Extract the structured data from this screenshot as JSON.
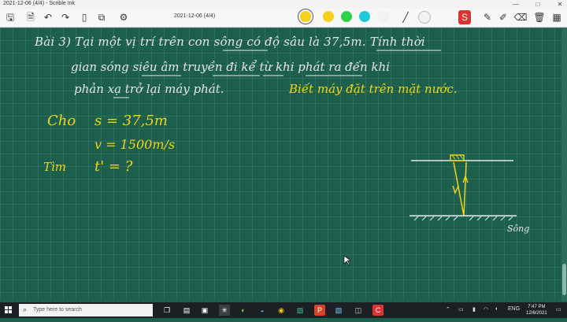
{
  "window": {
    "title": "2021-12-06 (4/4) - Scrible Ink",
    "minimize": "—",
    "maximize": "□",
    "close": "✕"
  },
  "toolbar": {
    "doc_title": "2021-12-06 (4/4)",
    "colors": [
      "#f5d11a",
      "#f5d11a",
      "#2fd34a",
      "#1ec8d8",
      "#f2f2f2"
    ]
  },
  "board": {
    "line1": "Bài 3)  Tại một vị trí trên con sông có độ sâu là 37,5m. Tính thời",
    "line2": "gian sóng siêu âm truyền đi kể từ khi phát ra đến khi",
    "line3_white": "phản xạ trở lại máy phát.",
    "line3_yellow": "Biết máy đặt trên mặt nước.",
    "given_label": "Cho",
    "given_s": "s = 37,5m",
    "given_v": "v = 1500m/s",
    "find_label": "Tìm",
    "find_t": "t' = ?",
    "diagram_label": "Sông"
  },
  "taskbar": {
    "search_placeholder": "Type here to search",
    "time": "7:47 PM",
    "date": "12/6/2021",
    "lang": "ENG"
  }
}
